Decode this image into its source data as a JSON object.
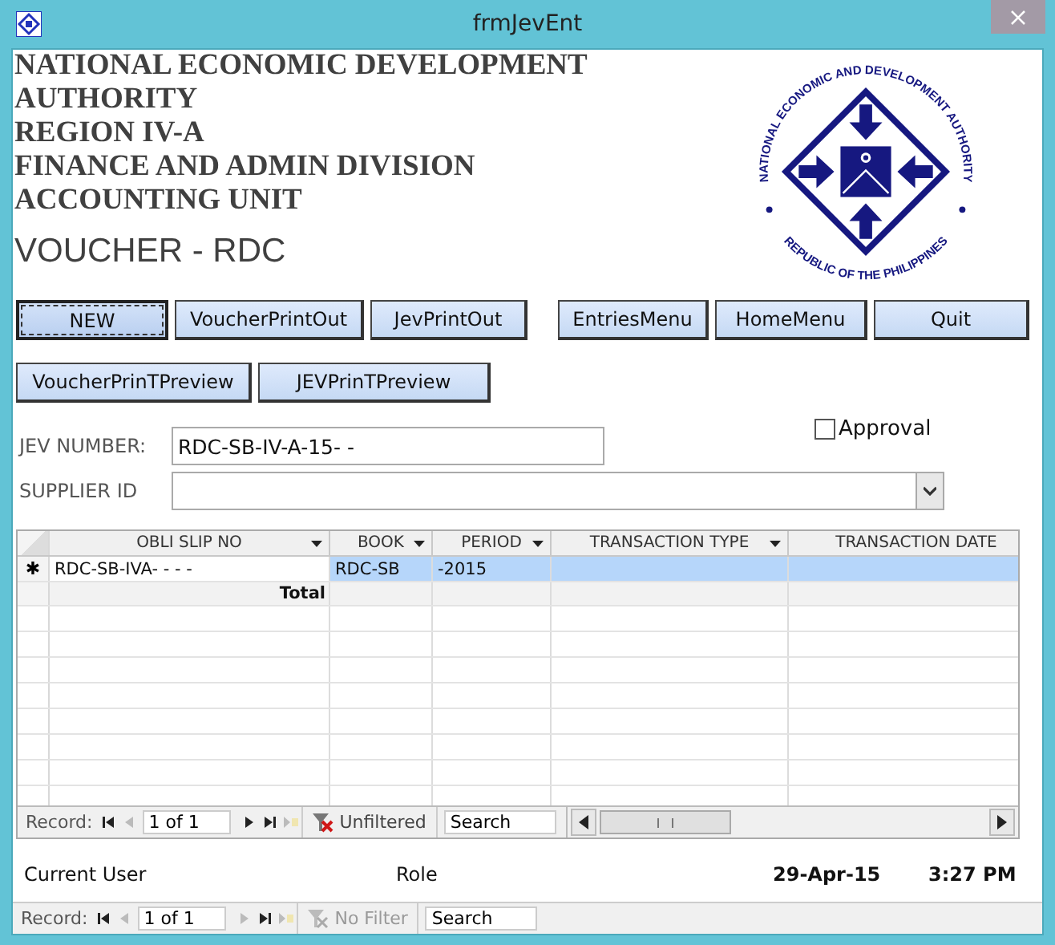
{
  "window": {
    "title": "frmJevEnt"
  },
  "header": {
    "lines": [
      "NATIONAL ECONOMIC DEVELOPMENT",
      "AUTHORITY",
      "REGION IV-A",
      "FINANCE AND ADMIN DIVISION",
      "ACCOUNTING UNIT"
    ],
    "subtitle": "VOUCHER - RDC"
  },
  "logo": {
    "top_text": "NATIONAL ECONOMIC AND DEVELOPMENT AUTHORITY",
    "bottom_text": "REPUBLIC OF THE PHILIPPINES"
  },
  "button_rows": [
    [
      {
        "label": "NEW",
        "focused": true
      },
      {
        "label": "VoucherPrintOut",
        "focused": false
      },
      {
        "label": "JevPrintOut",
        "focused": false
      },
      {
        "label": "EntriesMenu",
        "focused": false
      },
      {
        "label": "HomeMenu",
        "focused": false
      },
      {
        "label": "Quit",
        "focused": false
      }
    ],
    [
      {
        "label": "VoucherPrinTPreview",
        "focused": false
      },
      {
        "label": "JEVPrinTPreview",
        "focused": false
      }
    ]
  ],
  "fields": [
    {
      "label": "JEV NUMBER:",
      "value": "RDC-SB-IV-A-15-  -",
      "kind": "text"
    },
    {
      "label": "SUPPLIER ID",
      "kind": "combo"
    }
  ],
  "approval": {
    "label": "Approval",
    "checked": false
  },
  "datasheet": {
    "columns": [
      "OBLI SLIP NO",
      "BOOK",
      "PERIOD",
      "TRANSACTION TYPE",
      "TRANSACTION DATE"
    ],
    "rows": [
      {
        "kind": "new",
        "marker": "✱",
        "selected": true,
        "cells": [
          "RDC-SB-IVA-  -  -  -",
          "RDC-SB",
          "-2015",
          "",
          ""
        ]
      },
      {
        "kind": "total",
        "label": "Total"
      }
    ],
    "navigation": {
      "label": "Record:",
      "position": "1 of 1",
      "buttons": [
        {
          "kind": "first",
          "disabled": false
        },
        {
          "kind": "prev",
          "disabled": true
        },
        {
          "kind": "next",
          "disabled": false
        },
        {
          "kind": "last",
          "disabled": false
        },
        {
          "kind": "new",
          "disabled": true
        }
      ],
      "filter": {
        "label": "Unfiltered",
        "disabled": false
      },
      "search": "Search"
    }
  },
  "footer": {
    "user": "Current User",
    "role": "Role",
    "date": "29-Apr-15",
    "time": "3:27 PM"
  },
  "form_navigation": {
    "label": "Record:",
    "position": "1 of 1",
    "buttons": [
      {
        "kind": "first",
        "disabled": false
      },
      {
        "kind": "prev",
        "disabled": true
      },
      {
        "kind": "next",
        "disabled": true
      },
      {
        "kind": "last",
        "disabled": false
      },
      {
        "kind": "new",
        "disabled": true
      }
    ],
    "filter": {
      "label": "No Filter",
      "disabled": true
    },
    "search": "Search"
  }
}
